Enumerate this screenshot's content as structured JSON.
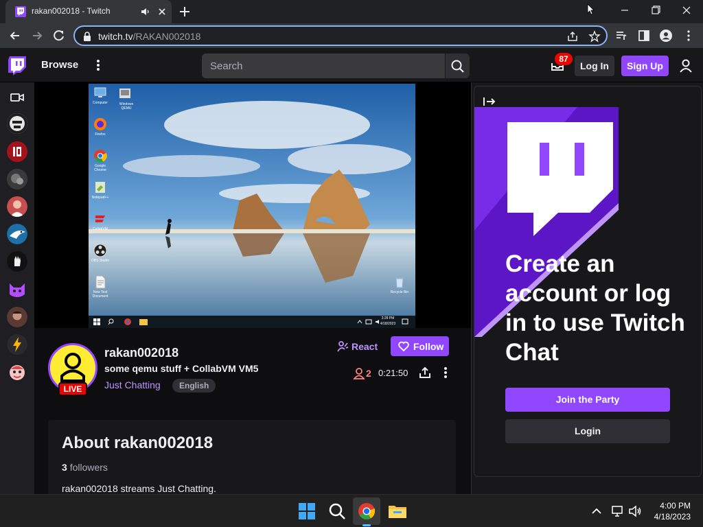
{
  "browser": {
    "tab_title": "rakan002018 - Twitch",
    "url_host": "twitch.tv",
    "url_path": "/RAKAN002018"
  },
  "nav": {
    "browse": "Browse",
    "search_placeholder": "Search",
    "inbox_count": "87",
    "login": "Log In",
    "signup": "Sign Up"
  },
  "sidebar": {
    "items": [
      "followed-channel-1",
      "followed-channel-2",
      "followed-channel-3",
      "followed-channel-4",
      "followed-channel-5",
      "followed-channel-6",
      "followed-channel-7",
      "followed-channel-8",
      "followed-channel-9"
    ]
  },
  "vm_desktop": {
    "icons": [
      "Computer",
      "Windows QEMU",
      "Firefox",
      "Google Chrome",
      "Notepad++",
      "CollabVM",
      "OBS Studio",
      "New Text Document",
      "Recycle Bin"
    ],
    "clock_time": "3:28 PM",
    "clock_date": "4/18/2023"
  },
  "stream": {
    "channel": "rakan002018",
    "title": "some qemu stuff + CollabVM VM5",
    "category": "Just Chatting",
    "tag": "English",
    "live": "LIVE",
    "react": "React",
    "follow": "Follow",
    "viewers": "2",
    "uptime": "0:21:50"
  },
  "about": {
    "title": "About rakan002018",
    "followers_count": "3",
    "followers_label": "followers",
    "description": "rakan002018 streams Just Chatting."
  },
  "chat": {
    "promo": "Create an account or log in to use Twitch Chat",
    "join": "Join the Party",
    "login": "Login"
  },
  "taskbar": {
    "time": "4:00 PM",
    "date": "4/18/2023"
  },
  "colors": {
    "twitch_purple": "#9147ff",
    "light_purple": "#bf94ff",
    "live_red": "#eb0400",
    "background": "#0e0e10"
  }
}
